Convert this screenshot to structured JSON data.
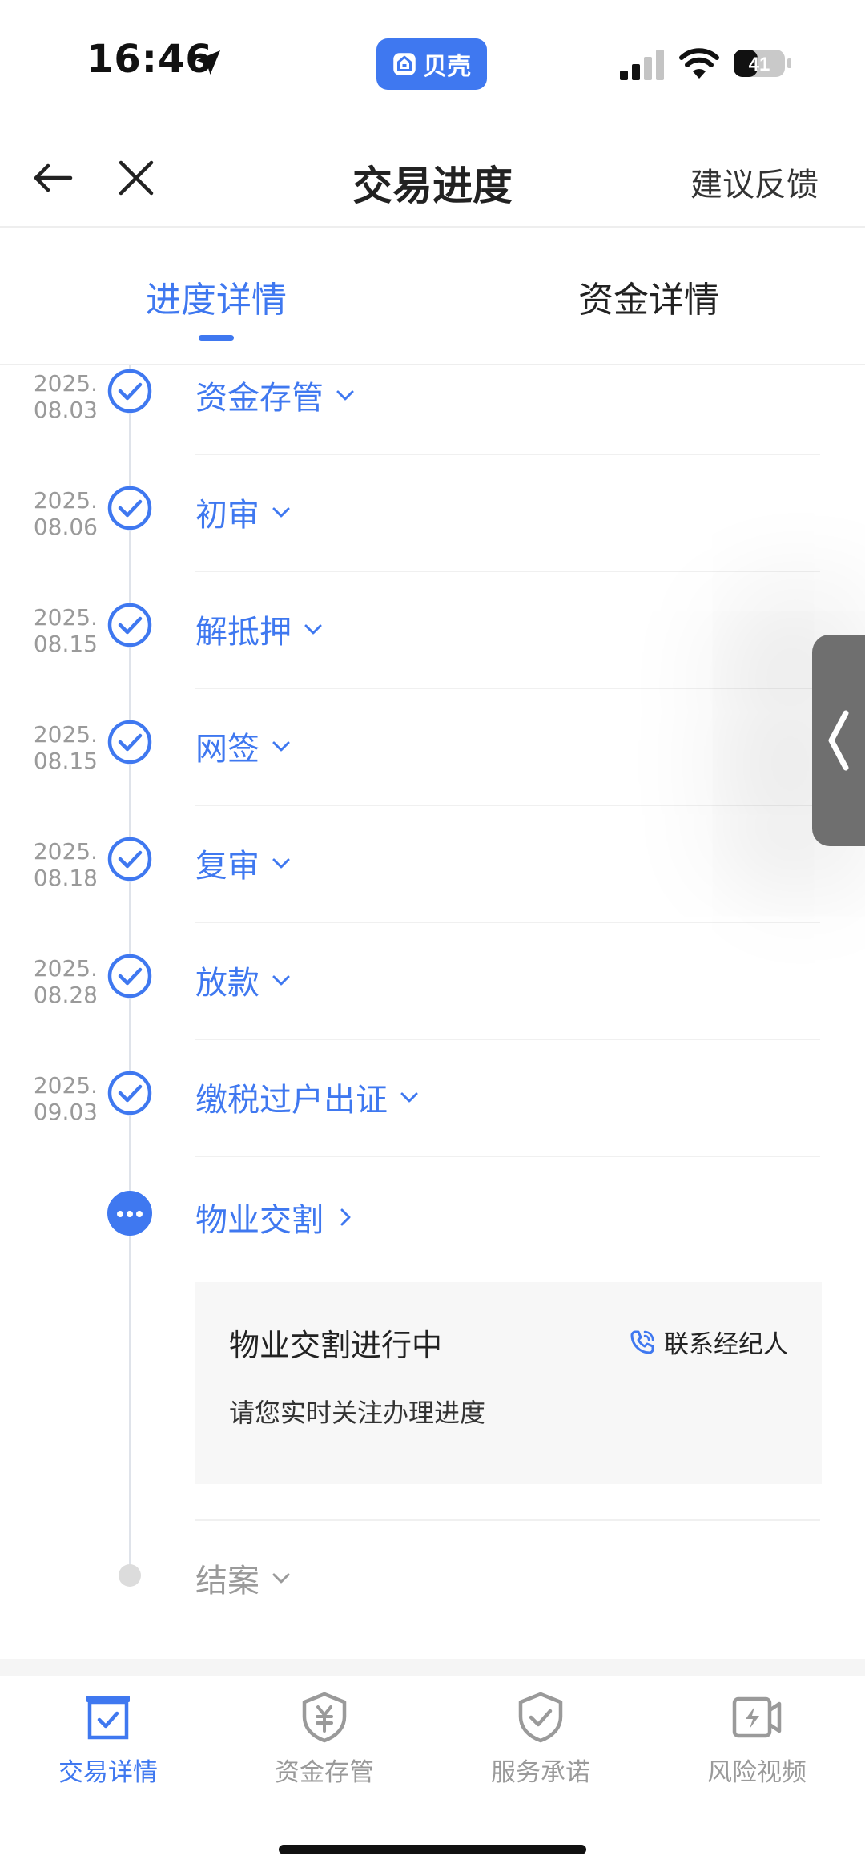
{
  "status_bar": {
    "time": "16:46",
    "app_name": "贝壳",
    "battery": "41"
  },
  "nav": {
    "title": "交易进度",
    "feedback": "建议反馈"
  },
  "tabs": [
    {
      "label": "进度详情",
      "active": true
    },
    {
      "label": "资金详情",
      "active": false
    }
  ],
  "timeline": {
    "completed": [
      {
        "date_year": "2025.",
        "date_day": "08.03",
        "name": "资金存管"
      },
      {
        "date_year": "2025.",
        "date_day": "08.06",
        "name": "初审"
      },
      {
        "date_year": "2025.",
        "date_day": "08.15",
        "name": "解抵押"
      },
      {
        "date_year": "2025.",
        "date_day": "08.15",
        "name": "网签"
      },
      {
        "date_year": "2025.",
        "date_day": "08.18",
        "name": "复审"
      },
      {
        "date_year": "2025.",
        "date_day": "08.28",
        "name": "放款"
      },
      {
        "date_year": "2025.",
        "date_day": "09.03",
        "name": "缴税过户出证"
      }
    ],
    "current": {
      "name": "物业交割",
      "card_title": "物业交割进行中",
      "contact": "联系经纪人",
      "card_subtitle": "请您实时关注办理进度"
    },
    "pending": {
      "name": "结案"
    }
  },
  "bottom_tabs": [
    {
      "label": "交易详情",
      "icon": "transaction-detail-icon",
      "active": true
    },
    {
      "label": "资金存管",
      "icon": "fund-custody-icon",
      "active": false
    },
    {
      "label": "服务承诺",
      "icon": "service-promise-icon",
      "active": false
    },
    {
      "label": "风险视频",
      "icon": "risk-video-icon",
      "active": false
    }
  ],
  "colors": {
    "accent": "#3f78f0",
    "muted": "#9a9a9a",
    "text": "#222222"
  }
}
